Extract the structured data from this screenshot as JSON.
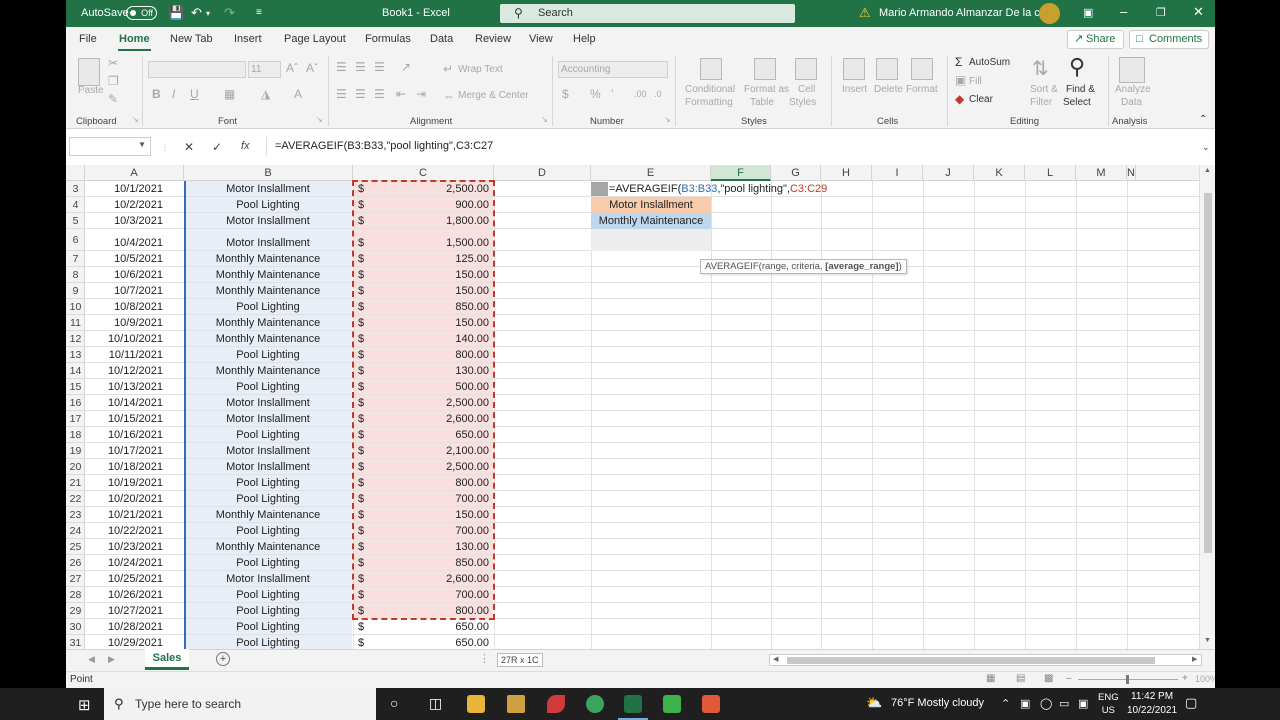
{
  "titlebar": {
    "autosave_label": "AutoSave",
    "autosave_state": "Off",
    "title": "Book1  -  Excel",
    "search_placeholder": "Search",
    "user_name": "Mario Armando Almanzar De la cruz"
  },
  "menu": {
    "tabs": [
      "File",
      "Home",
      "New Tab",
      "Insert",
      "Page Layout",
      "Formulas",
      "Data",
      "Review",
      "View",
      "Help"
    ],
    "active_tab": "Home",
    "share_label": "Share",
    "comments_label": "Comments"
  },
  "ribbon": {
    "clipboard": {
      "paste": "Paste",
      "label": "Clipboard"
    },
    "font": {
      "size": "11",
      "label": "Font"
    },
    "alignment": {
      "wrap_text": "Wrap Text",
      "merge_center": "Merge & Center",
      "label": "Alignment"
    },
    "number": {
      "format": "Accounting",
      "label": "Number"
    },
    "styles": {
      "conditional": [
        "Conditional",
        "Formatting"
      ],
      "format_as": [
        "Format as",
        "Table"
      ],
      "cell": [
        "Cell",
        "Styles"
      ],
      "label": "Styles"
    },
    "cells": {
      "insert": "Insert",
      "delete": "Delete",
      "format": "Format",
      "label": "Cells"
    },
    "editing": {
      "autosum": "AutoSum",
      "fill": "Fill",
      "clear": "Clear",
      "sort": [
        "Sort &",
        "Filter"
      ],
      "find": [
        "Find &",
        "Select"
      ],
      "label": "Editing"
    },
    "analysis": {
      "analyze": [
        "Analyze",
        "Data"
      ],
      "label": "Analysis"
    }
  },
  "formula_bar": {
    "formula": "=AVERAGEIF(B3:B33,\"pool lighting\",C3:C27"
  },
  "grid": {
    "columns": [
      "A",
      "B",
      "C",
      "D",
      "E",
      "F",
      "G",
      "H",
      "I",
      "J",
      "K",
      "L",
      "M",
      "N"
    ],
    "selected_column": "F",
    "currency": "$",
    "rows": [
      {
        "n": "3",
        "date": "10/1/2021",
        "type": "Motor Inslallment",
        "amount": "2,500.00"
      },
      {
        "n": "4",
        "date": "10/2/2021",
        "type": "Pool Lighting",
        "amount": "900.00"
      },
      {
        "n": "5",
        "date": "10/3/2021",
        "type": "Motor Inslallment",
        "amount": "1,800.00"
      },
      {
        "n": "6",
        "date": "10/4/2021",
        "type": "Motor Inslallment",
        "amount": "1,500.00"
      },
      {
        "n": "7",
        "date": "10/5/2021",
        "type": "Monthly Maintenance",
        "amount": "125.00"
      },
      {
        "n": "8",
        "date": "10/6/2021",
        "type": "Monthly Maintenance",
        "amount": "150.00"
      },
      {
        "n": "9",
        "date": "10/7/2021",
        "type": "Monthly Maintenance",
        "amount": "150.00"
      },
      {
        "n": "10",
        "date": "10/8/2021",
        "type": "Pool Lighting",
        "amount": "850.00"
      },
      {
        "n": "11",
        "date": "10/9/2021",
        "type": "Monthly Maintenance",
        "amount": "150.00"
      },
      {
        "n": "12",
        "date": "10/10/2021",
        "type": "Monthly Maintenance",
        "amount": "140.00"
      },
      {
        "n": "13",
        "date": "10/11/2021",
        "type": "Pool Lighting",
        "amount": "800.00"
      },
      {
        "n": "14",
        "date": "10/12/2021",
        "type": "Monthly Maintenance",
        "amount": "130.00"
      },
      {
        "n": "15",
        "date": "10/13/2021",
        "type": "Pool Lighting",
        "amount": "500.00"
      },
      {
        "n": "16",
        "date": "10/14/2021",
        "type": "Motor Inslallment",
        "amount": "2,500.00"
      },
      {
        "n": "17",
        "date": "10/15/2021",
        "type": "Motor Inslallment",
        "amount": "2,600.00"
      },
      {
        "n": "18",
        "date": "10/16/2021",
        "type": "Pool Lighting",
        "amount": "650.00"
      },
      {
        "n": "19",
        "date": "10/17/2021",
        "type": "Motor Inslallment",
        "amount": "2,100.00"
      },
      {
        "n": "20",
        "date": "10/18/2021",
        "type": "Motor Inslallment",
        "amount": "2,500.00"
      },
      {
        "n": "21",
        "date": "10/19/2021",
        "type": "Pool Lighting",
        "amount": "800.00"
      },
      {
        "n": "22",
        "date": "10/20/2021",
        "type": "Pool Lighting",
        "amount": "700.00"
      },
      {
        "n": "23",
        "date": "10/21/2021",
        "type": "Monthly Maintenance",
        "amount": "150.00"
      },
      {
        "n": "24",
        "date": "10/22/2021",
        "type": "Pool Lighting",
        "amount": "700.00"
      },
      {
        "n": "25",
        "date": "10/23/2021",
        "type": "Monthly Maintenance",
        "amount": "130.00"
      },
      {
        "n": "26",
        "date": "10/24/2021",
        "type": "Pool Lighting",
        "amount": "850.00"
      },
      {
        "n": "27",
        "date": "10/25/2021",
        "type": "Motor Inslallment",
        "amount": "2,600.00"
      },
      {
        "n": "28",
        "date": "10/26/2021",
        "type": "Pool Lighting",
        "amount": "700.00"
      },
      {
        "n": "29",
        "date": "10/27/2021",
        "type": "Pool Lighting",
        "amount": "800.00"
      },
      {
        "n": "30",
        "date": "10/28/2021",
        "type": "Pool Lighting",
        "amount": "650.00"
      },
      {
        "n": "31",
        "date": "10/29/2021",
        "type": "Pool Lighting",
        "amount": "650.00"
      }
    ],
    "e_column": {
      "formula_prefix": "=AVERAGEIF(",
      "formula_range": "B3:B33",
      "formula_criteria": ",\"pool lighting\",",
      "formula_avg_range": "C3:C29",
      "e4": "Motor Inslallment",
      "e5": "Monthly Maintenance"
    },
    "tooltip": {
      "prefix": "AVERAGEIF(range, criteria, ",
      "bold": "[average_range]",
      "suffix": ")"
    },
    "colors": {
      "colB": "#e7eef8",
      "colC": "#f9e0df",
      "e4": "#f8cbad",
      "e5": "#bdd7ee",
      "e6": "#ededed"
    }
  },
  "sheetbar": {
    "sheet_name": "Sales",
    "selection_size": "27R x 1C"
  },
  "status": {
    "mode": "Point",
    "zoom": "100%"
  },
  "taskbar": {
    "search_placeholder": "Type here to search",
    "weather": "76°F  Mostly cloudy",
    "lang": "ENG",
    "region": "US",
    "time": "11:42 PM",
    "date": "10/22/2021"
  }
}
